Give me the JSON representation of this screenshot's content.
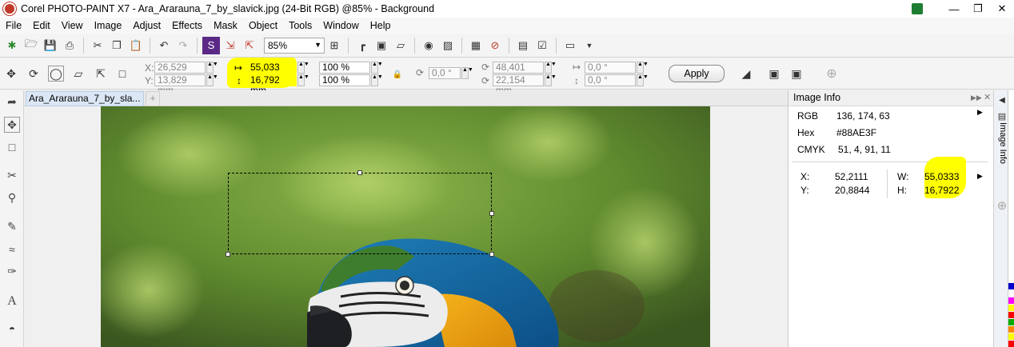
{
  "title": "Corel PHOTO-PAINT X7 - Ara_Ararauna_7_by_slavick.jpg (24-Bit RGB) @85% - Background",
  "menu": [
    "File",
    "Edit",
    "View",
    "Image",
    "Adjust",
    "Effects",
    "Mask",
    "Object",
    "Tools",
    "Window",
    "Help"
  ],
  "toolbar": {
    "zoom": "85%"
  },
  "property_bar": {
    "x": "26,529 mm",
    "y": "13,829 mm",
    "width": "55,033 mm",
    "height": "16,792 mm",
    "scale_w": "100 %",
    "scale_h": "100 %",
    "rotation": "0,0 °",
    "center_x": "48,401 mm",
    "center_y": "22,154 mm",
    "skew_h": "0,0 °",
    "skew_v": "0,0 °",
    "apply_label": "Apply"
  },
  "document": {
    "tab_label": "Ara_Ararauna_7_by_sla...",
    "add_tab": "+"
  },
  "image_info": {
    "header": "Image Info",
    "side_tab_label": "Image Info",
    "color": {
      "rgb_label": "RGB",
      "rgb_value": "136, 174,  63",
      "hex_label": "Hex",
      "hex_value": "#88AE3F",
      "cmyk_label": "CMYK",
      "cmyk_value": "51,  4, 91, 11"
    },
    "position": {
      "x_label": "X:",
      "x_value": "52,2111",
      "y_label": "Y:",
      "y_value": "20,8844",
      "w_label": "W:",
      "w_value": "55,0333",
      "h_label": "H:",
      "h_value": "16,7922"
    }
  },
  "colors": {
    "highlight": "#ffff00",
    "swatch_sample": "#88AE3F",
    "palette_swatches": [
      "#0000cc",
      "#ffffff",
      "#ff00ff",
      "#ffff00",
      "#ff0000",
      "#00aa00",
      "#ff8800",
      "#ffff00",
      "#ff0000"
    ]
  }
}
